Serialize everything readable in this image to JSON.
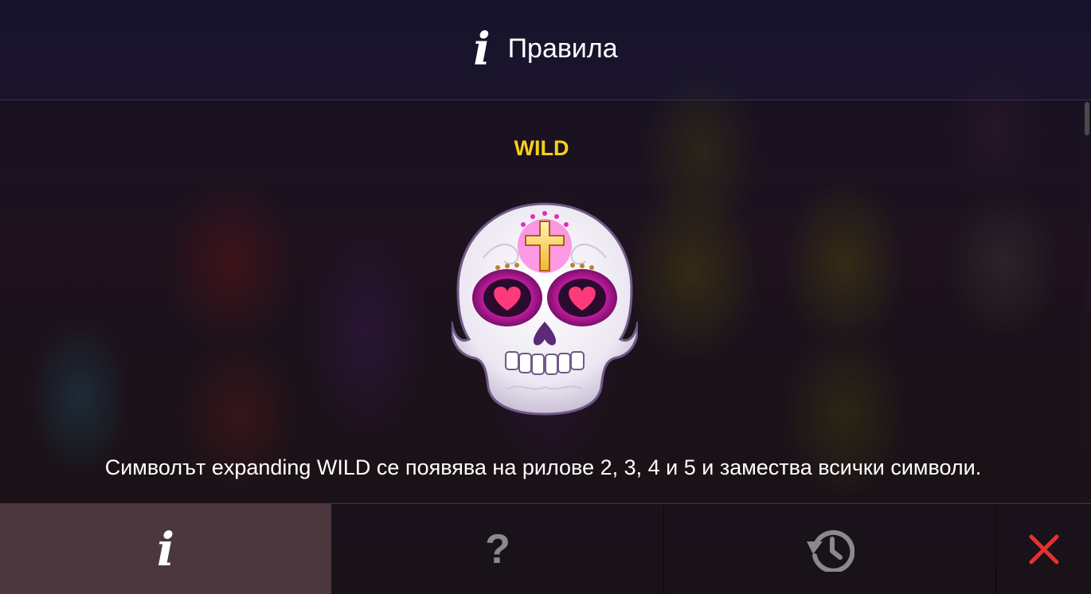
{
  "header": {
    "icon": "info-icon",
    "info_glyph": "i",
    "title": "Правила"
  },
  "content": {
    "symbol_name": "WILD",
    "symbol_image": "sugar-skull-icon",
    "description": "Символът expanding WILD се появява на рилове 2, 3, 4 и 5 и замества всички символи."
  },
  "tabs": [
    {
      "name": "info",
      "icon": "info-icon",
      "glyph": "i",
      "active": true
    },
    {
      "name": "help",
      "icon": "question-icon",
      "glyph": "?",
      "active": false
    },
    {
      "name": "history",
      "icon": "history-icon",
      "active": false
    },
    {
      "name": "close",
      "icon": "close-icon",
      "active": false
    }
  ],
  "colors": {
    "wild_label": "#f5cf1c",
    "close_icon": "#e6322f",
    "inactive_icon": "#8a8a8a"
  }
}
